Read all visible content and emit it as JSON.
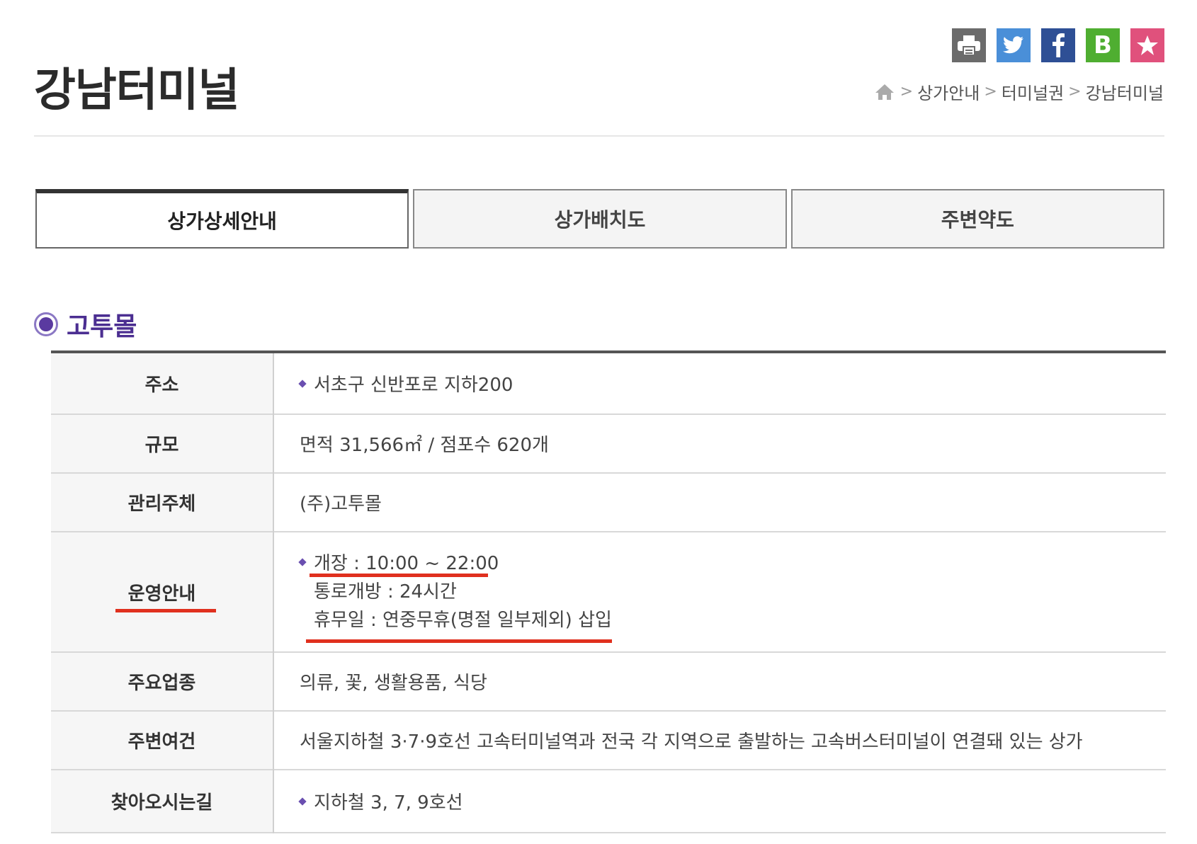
{
  "header": {
    "title": "강남터미널",
    "share": [
      {
        "name": "print",
        "color": "#6b6b6b"
      },
      {
        "name": "twitter",
        "color": "#4a8fd8"
      },
      {
        "name": "facebook",
        "color": "#2e4f95"
      },
      {
        "name": "blog",
        "label": "B",
        "color": "#4fae31"
      },
      {
        "name": "favorite",
        "color": "#e0517c"
      }
    ],
    "breadcrumb": [
      "상가안내",
      "터미널권",
      "강남터미널"
    ]
  },
  "tabs": [
    {
      "label": "상가상세안내",
      "active": true
    },
    {
      "label": "상가배치도",
      "active": false
    },
    {
      "label": "주변약도",
      "active": false
    }
  ],
  "section": {
    "title": "고투몰"
  },
  "table": {
    "address": {
      "label": "주소",
      "value": "서초구 신반포로 지하200"
    },
    "scale": {
      "label": "규모",
      "value": "면적 31,566㎡ / 점포수 620개"
    },
    "manager": {
      "label": "관리주체",
      "value": "(주)고투몰"
    },
    "operation": {
      "label": "운영안내",
      "hours": "개장 : 10:00 ~ 22:00",
      "passage": "통로개방 : 24시간",
      "holiday": "휴무일 : 연중무휴(명절 일부제외) 삽입"
    },
    "business": {
      "label": "주요업종",
      "value": "의류, 꽃, 생활용품, 식당"
    },
    "surroundings": {
      "label": "주변여건",
      "value": "서울지하철 3·7·9호선 고속터미널역과 전국 각 지역으로 출발하는 고속버스터미널이 연결돼 있는 상가"
    },
    "directions": {
      "label": "찾아오시는길",
      "value": "지하철 3, 7, 9호선"
    }
  },
  "colors": {
    "accent": "#4b2e91",
    "highlight": "#e0301e"
  }
}
